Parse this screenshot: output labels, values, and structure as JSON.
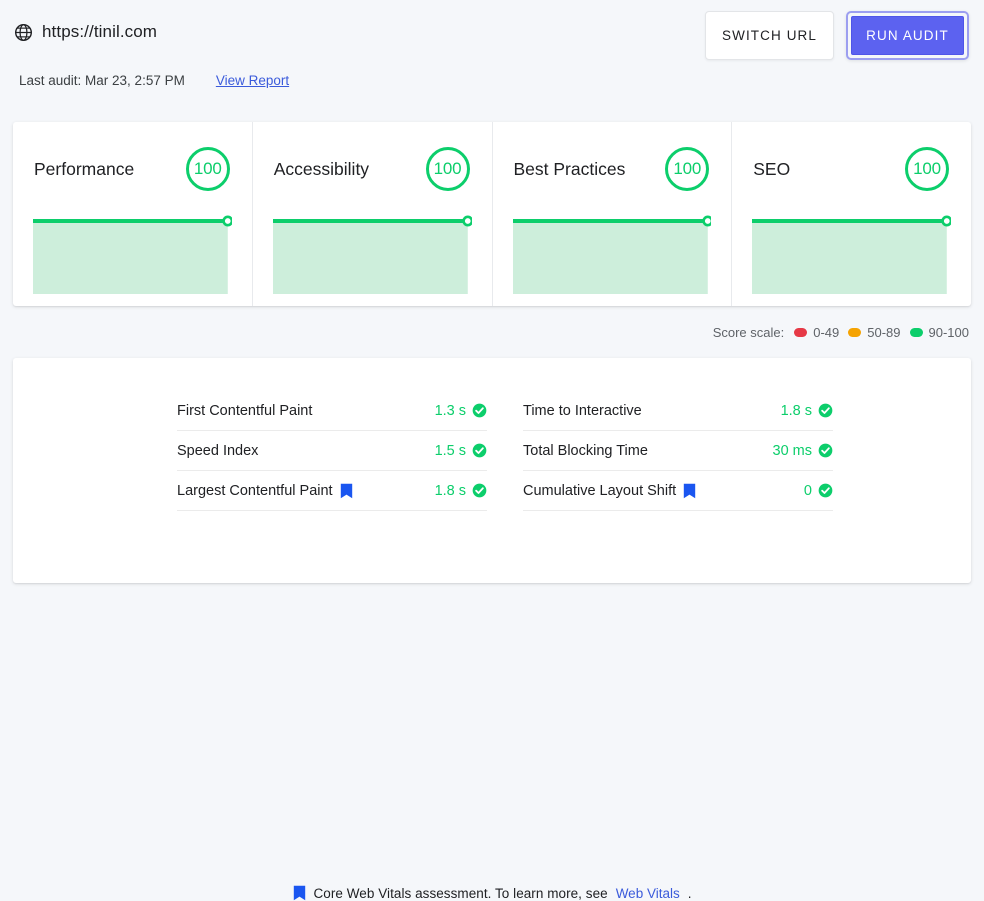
{
  "header": {
    "globe_icon": "globe-icon",
    "url": "https://tinil.com",
    "last_audit": "Last audit: Mar 23, 2:57 PM",
    "view_report_label": "View Report",
    "switch_url_label": "SWITCH URL",
    "run_audit_label": "RUN AUDIT"
  },
  "categories": [
    {
      "title": "Performance",
      "score": "100"
    },
    {
      "title": "Accessibility",
      "score": "100"
    },
    {
      "title": "Best Practices",
      "score": "100"
    },
    {
      "title": "SEO",
      "score": "100"
    }
  ],
  "scale": {
    "label": "Score scale:",
    "items": [
      {
        "range": "0-49",
        "color": "#e63946"
      },
      {
        "range": "50-89",
        "color": "#f5a302"
      },
      {
        "range": "90-100",
        "color": "#0cce6b"
      }
    ]
  },
  "metrics": {
    "left": [
      {
        "name": "First Contentful Paint",
        "value": "1.3 s",
        "core_vital": false,
        "status": "pass"
      },
      {
        "name": "Speed Index",
        "value": "1.5 s",
        "core_vital": false,
        "status": "pass"
      },
      {
        "name": "Largest Contentful Paint",
        "value": "1.8 s",
        "core_vital": true,
        "status": "pass"
      }
    ],
    "right": [
      {
        "name": "Time to Interactive",
        "value": "1.8 s",
        "core_vital": false,
        "status": "pass"
      },
      {
        "name": "Total Blocking Time",
        "value": "30 ms",
        "core_vital": false,
        "status": "pass"
      },
      {
        "name": "Cumulative Layout Shift",
        "value": "0",
        "core_vital": true,
        "status": "pass"
      }
    ]
  },
  "vitals_note": {
    "flag_icon": "bookmark-icon",
    "text": "Core Web Vitals assessment. To learn more, see",
    "link_label": "Web Vitals",
    "suffix": "."
  },
  "chart_data": {
    "type": "line",
    "title": "Category score sparklines",
    "series": [
      {
        "name": "Performance",
        "values": [
          100,
          100,
          100,
          100,
          100
        ]
      },
      {
        "name": "Accessibility",
        "values": [
          100,
          100,
          100,
          100,
          100
        ]
      },
      {
        "name": "Best Practices",
        "values": [
          100,
          100,
          100,
          100,
          100
        ]
      },
      {
        "name": "SEO",
        "values": [
          100,
          100,
          100,
          100,
          100
        ]
      }
    ],
    "ylim": [
      0,
      100
    ],
    "grid": false,
    "legend": "none",
    "line_color": "#0cce6b",
    "fill_color": "#cdeedb"
  },
  "colors": {
    "page_bg": "#f5f7fa",
    "card_bg": "#ffffff",
    "pass_green": "#0cce6b",
    "accent_indigo": "#5c62f0",
    "link_blue": "#3b5bdb",
    "vital_flag_blue": "#1a56f0"
  }
}
